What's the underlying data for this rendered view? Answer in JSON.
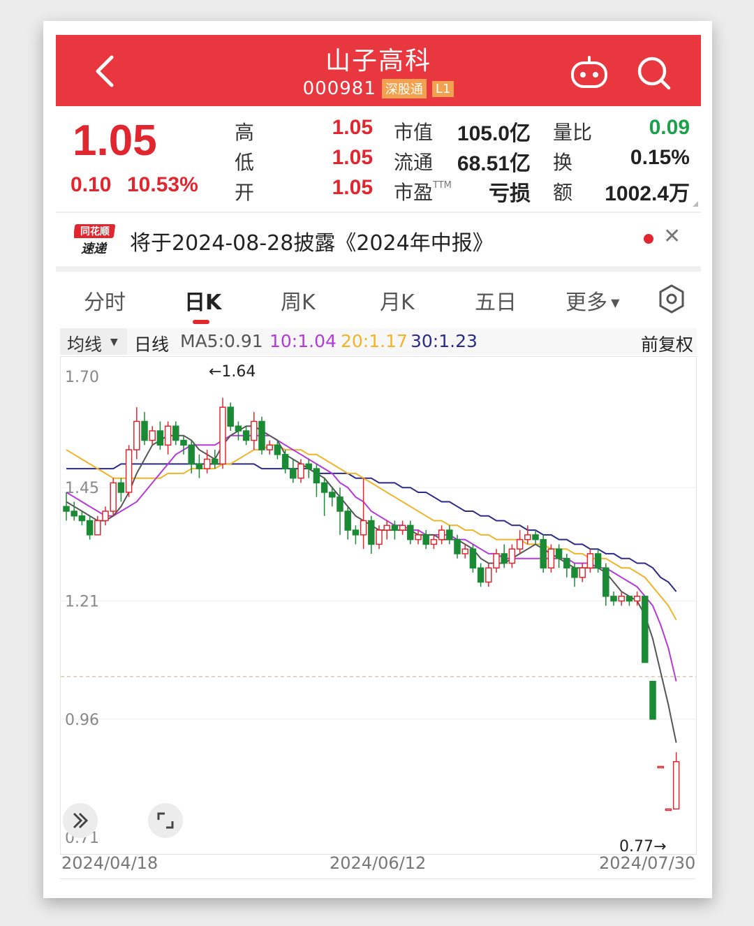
{
  "header": {
    "title": "山子高科",
    "code": "000981",
    "badge_connect": "深股通",
    "badge_level": "L1"
  },
  "quote": {
    "price": "1.05",
    "change": "0.10",
    "change_pct": "10.53%",
    "stats": [
      {
        "label": "高",
        "value": "1.05"
      },
      {
        "label": "低",
        "value": "1.05"
      },
      {
        "label": "开",
        "value": "1.05"
      },
      {
        "label": "市值",
        "value": "105.0亿"
      },
      {
        "label": "流通",
        "value": "68.51亿"
      },
      {
        "label": "市盈",
        "sup": "TTM",
        "value": "亏损"
      },
      {
        "label": "量比",
        "value": "0.09"
      },
      {
        "label": "换",
        "value": "0.15%"
      },
      {
        "label": "额",
        "value": "1002.4万"
      }
    ]
  },
  "notice": {
    "logo_line1": "同花顺",
    "logo_line2": "速递",
    "text": "将于2024-08-28披露《2024年中报》"
  },
  "tabs": [
    "分时",
    "日K",
    "周K",
    "月K",
    "五日",
    "更多"
  ],
  "ma_bar": {
    "selector": "均线",
    "period": "日线",
    "ma5": "MA5:0.91",
    "ma10": "10:1.04",
    "ma20": "20:1.17",
    "ma30": "30:1.23",
    "adjust": "前复权"
  },
  "colors": {
    "header": "#e8373e",
    "up": "#e0262e",
    "down": "#1a8a35",
    "ma5": "#555555",
    "ma10": "#b33ad9",
    "ma20": "#f0b429",
    "ma30": "#2a2a88"
  },
  "chart_data": {
    "type": "candlestick",
    "y_ticks": [
      "1.70",
      "1.45",
      "1.21",
      "0.96",
      "0.71"
    ],
    "ylim": [
      0.71,
      1.7
    ],
    "x_labels": [
      "2024/04/18",
      "2024/06/12",
      "2024/07/30"
    ],
    "annotations": {
      "high": "←1.64",
      "low": "0.77→"
    },
    "candles": [
      [
        1.41,
        1.4,
        1.44,
        1.38
      ],
      [
        1.4,
        1.39,
        1.42,
        1.38
      ],
      [
        1.39,
        1.38,
        1.4,
        1.37
      ],
      [
        1.38,
        1.35,
        1.39,
        1.34
      ],
      [
        1.35,
        1.38,
        1.39,
        1.35
      ],
      [
        1.38,
        1.4,
        1.41,
        1.37
      ],
      [
        1.4,
        1.46,
        1.47,
        1.39
      ],
      [
        1.46,
        1.44,
        1.47,
        1.42
      ],
      [
        1.44,
        1.53,
        1.54,
        1.43
      ],
      [
        1.53,
        1.59,
        1.62,
        1.51
      ],
      [
        1.59,
        1.55,
        1.61,
        1.54
      ],
      [
        1.55,
        1.57,
        1.58,
        1.54
      ],
      [
        1.57,
        1.54,
        1.59,
        1.53
      ],
      [
        1.54,
        1.58,
        1.59,
        1.52
      ],
      [
        1.58,
        1.55,
        1.59,
        1.54
      ],
      [
        1.55,
        1.54,
        1.56,
        1.52
      ],
      [
        1.54,
        1.5,
        1.55,
        1.48
      ],
      [
        1.5,
        1.49,
        1.52,
        1.47
      ],
      [
        1.49,
        1.51,
        1.53,
        1.48
      ],
      [
        1.51,
        1.5,
        1.53,
        1.49
      ],
      [
        1.5,
        1.62,
        1.64,
        1.49
      ],
      [
        1.62,
        1.58,
        1.63,
        1.57
      ],
      [
        1.58,
        1.57,
        1.59,
        1.55
      ],
      [
        1.57,
        1.55,
        1.58,
        1.54
      ],
      [
        1.55,
        1.59,
        1.61,
        1.53
      ],
      [
        1.59,
        1.53,
        1.6,
        1.52
      ],
      [
        1.53,
        1.54,
        1.55,
        1.52
      ],
      [
        1.54,
        1.52,
        1.55,
        1.51
      ],
      [
        1.52,
        1.49,
        1.53,
        1.48
      ],
      [
        1.49,
        1.47,
        1.51,
        1.46
      ],
      [
        1.47,
        1.5,
        1.51,
        1.46
      ],
      [
        1.5,
        1.49,
        1.51,
        1.47
      ],
      [
        1.49,
        1.46,
        1.5,
        1.43
      ],
      [
        1.46,
        1.44,
        1.47,
        1.39
      ],
      [
        1.44,
        1.43,
        1.45,
        1.41
      ],
      [
        1.43,
        1.4,
        1.45,
        1.35
      ],
      [
        1.4,
        1.36,
        1.41,
        1.34
      ],
      [
        1.36,
        1.35,
        1.37,
        1.33
      ],
      [
        1.35,
        1.38,
        1.47,
        1.32
      ],
      [
        1.38,
        1.33,
        1.39,
        1.31
      ],
      [
        1.33,
        1.36,
        1.37,
        1.32
      ],
      [
        1.36,
        1.37,
        1.38,
        1.34
      ],
      [
        1.37,
        1.36,
        1.38,
        1.34
      ],
      [
        1.36,
        1.37,
        1.38,
        1.35
      ],
      [
        1.37,
        1.34,
        1.38,
        1.33
      ],
      [
        1.34,
        1.35,
        1.36,
        1.33
      ],
      [
        1.35,
        1.33,
        1.36,
        1.32
      ],
      [
        1.33,
        1.34,
        1.35,
        1.32
      ],
      [
        1.34,
        1.36,
        1.37,
        1.33
      ],
      [
        1.36,
        1.34,
        1.37,
        1.33
      ],
      [
        1.34,
        1.31,
        1.35,
        1.3
      ],
      [
        1.31,
        1.32,
        1.33,
        1.3
      ],
      [
        1.32,
        1.28,
        1.33,
        1.27
      ],
      [
        1.28,
        1.25,
        1.29,
        1.24
      ],
      [
        1.25,
        1.28,
        1.29,
        1.24
      ],
      [
        1.28,
        1.31,
        1.32,
        1.27
      ],
      [
        1.31,
        1.29,
        1.33,
        1.28
      ],
      [
        1.29,
        1.32,
        1.33,
        1.28
      ],
      [
        1.32,
        1.34,
        1.36,
        1.31
      ],
      [
        1.34,
        1.35,
        1.37,
        1.33
      ],
      [
        1.35,
        1.34,
        1.36,
        1.33
      ],
      [
        1.34,
        1.28,
        1.35,
        1.27
      ],
      [
        1.28,
        1.32,
        1.33,
        1.27
      ],
      [
        1.32,
        1.3,
        1.33,
        1.28
      ],
      [
        1.3,
        1.28,
        1.31,
        1.26
      ],
      [
        1.28,
        1.26,
        1.29,
        1.24
      ],
      [
        1.26,
        1.28,
        1.29,
        1.25
      ],
      [
        1.28,
        1.31,
        1.32,
        1.27
      ],
      [
        1.31,
        1.28,
        1.32,
        1.27
      ],
      [
        1.28,
        1.22,
        1.29,
        1.2
      ],
      [
        1.22,
        1.21,
        1.23,
        1.2
      ],
      [
        1.21,
        1.22,
        1.23,
        1.2
      ],
      [
        1.22,
        1.21,
        1.22,
        1.2
      ],
      [
        1.21,
        1.22,
        1.23,
        1.2
      ],
      [
        1.22,
        1.08,
        1.22,
        1.08
      ],
      [
        1.04,
        0.96,
        1.04,
        0.96
      ],
      [
        0.86,
        0.86,
        0.86,
        0.86
      ],
      [
        0.77,
        0.77,
        0.77,
        0.77
      ],
      [
        0.77,
        0.87,
        0.89,
        0.77
      ]
    ],
    "ma5": [
      1.42,
      1.41,
      1.4,
      1.39,
      1.38,
      1.38,
      1.39,
      1.41,
      1.44,
      1.48,
      1.51,
      1.54,
      1.55,
      1.56,
      1.56,
      1.56,
      1.55,
      1.53,
      1.52,
      1.51,
      1.54,
      1.56,
      1.57,
      1.58,
      1.58,
      1.57,
      1.56,
      1.55,
      1.52,
      1.51,
      1.5,
      1.49,
      1.48,
      1.47,
      1.45,
      1.43,
      1.41,
      1.39,
      1.38,
      1.37,
      1.36,
      1.36,
      1.36,
      1.36,
      1.36,
      1.35,
      1.35,
      1.35,
      1.34,
      1.34,
      1.34,
      1.33,
      1.32,
      1.3,
      1.29,
      1.29,
      1.29,
      1.3,
      1.31,
      1.32,
      1.33,
      1.32,
      1.31,
      1.3,
      1.29,
      1.28,
      1.28,
      1.28,
      1.28,
      1.27,
      1.25,
      1.23,
      1.22,
      1.21,
      1.18,
      1.13,
      1.06,
      0.99,
      0.91
    ],
    "ma10": [
      1.44,
      1.43,
      1.42,
      1.41,
      1.4,
      1.39,
      1.39,
      1.4,
      1.41,
      1.42,
      1.44,
      1.46,
      1.48,
      1.5,
      1.52,
      1.53,
      1.54,
      1.54,
      1.54,
      1.54,
      1.55,
      1.56,
      1.56,
      1.56,
      1.56,
      1.56,
      1.56,
      1.55,
      1.54,
      1.53,
      1.52,
      1.51,
      1.5,
      1.49,
      1.48,
      1.46,
      1.45,
      1.43,
      1.42,
      1.4,
      1.39,
      1.38,
      1.37,
      1.37,
      1.36,
      1.36,
      1.35,
      1.35,
      1.35,
      1.35,
      1.34,
      1.34,
      1.33,
      1.32,
      1.31,
      1.31,
      1.3,
      1.3,
      1.3,
      1.3,
      1.3,
      1.3,
      1.3,
      1.3,
      1.3,
      1.29,
      1.29,
      1.29,
      1.28,
      1.28,
      1.27,
      1.26,
      1.25,
      1.24,
      1.22,
      1.2,
      1.16,
      1.11,
      1.04
    ],
    "ma20": [
      1.53,
      1.52,
      1.51,
      1.5,
      1.49,
      1.48,
      1.47,
      1.47,
      1.47,
      1.47,
      1.47,
      1.47,
      1.47,
      1.48,
      1.48,
      1.48,
      1.49,
      1.49,
      1.49,
      1.49,
      1.5,
      1.5,
      1.51,
      1.52,
      1.53,
      1.53,
      1.54,
      1.54,
      1.53,
      1.53,
      1.53,
      1.52,
      1.52,
      1.51,
      1.5,
      1.49,
      1.48,
      1.48,
      1.47,
      1.46,
      1.45,
      1.44,
      1.43,
      1.42,
      1.41,
      1.4,
      1.39,
      1.38,
      1.38,
      1.37,
      1.37,
      1.36,
      1.36,
      1.35,
      1.35,
      1.34,
      1.34,
      1.34,
      1.34,
      1.33,
      1.33,
      1.33,
      1.32,
      1.32,
      1.32,
      1.31,
      1.31,
      1.3,
      1.3,
      1.3,
      1.29,
      1.28,
      1.28,
      1.27,
      1.26,
      1.24,
      1.22,
      1.2,
      1.17
    ],
    "ma30": [
      1.49,
      1.49,
      1.49,
      1.49,
      1.49,
      1.49,
      1.49,
      1.5,
      1.5,
      1.5,
      1.5,
      1.5,
      1.5,
      1.5,
      1.5,
      1.5,
      1.5,
      1.5,
      1.5,
      1.5,
      1.5,
      1.5,
      1.5,
      1.5,
      1.5,
      1.49,
      1.49,
      1.49,
      1.49,
      1.49,
      1.49,
      1.49,
      1.48,
      1.48,
      1.48,
      1.48,
      1.48,
      1.47,
      1.47,
      1.47,
      1.46,
      1.46,
      1.46,
      1.45,
      1.45,
      1.44,
      1.44,
      1.43,
      1.42,
      1.42,
      1.41,
      1.4,
      1.4,
      1.39,
      1.39,
      1.38,
      1.38,
      1.37,
      1.37,
      1.36,
      1.36,
      1.35,
      1.35,
      1.34,
      1.34,
      1.33,
      1.33,
      1.32,
      1.32,
      1.31,
      1.31,
      1.3,
      1.3,
      1.29,
      1.29,
      1.28,
      1.26,
      1.25,
      1.23
    ],
    "reference_price": 1.05
  }
}
